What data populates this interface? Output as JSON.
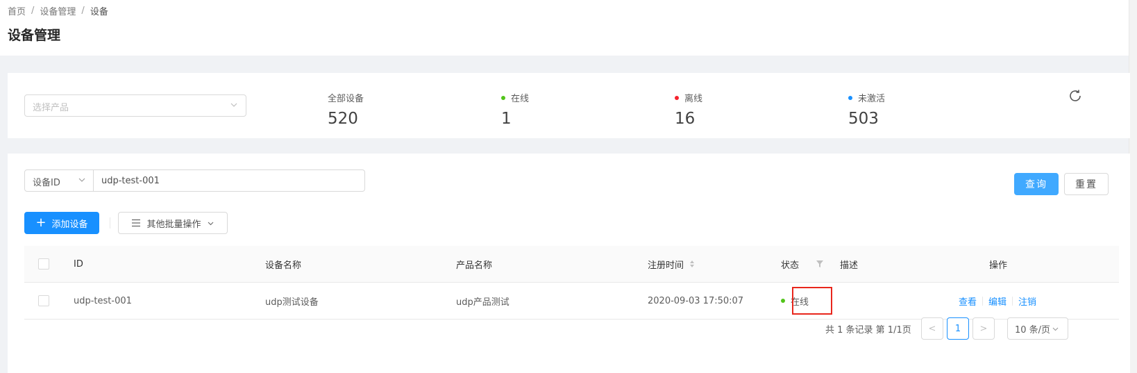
{
  "breadcrumb": {
    "items": [
      "首页",
      "设备管理",
      "设备"
    ],
    "separator": "/"
  },
  "page_title": "设备管理",
  "stats": {
    "product_select": {
      "placeholder": "选择产品"
    },
    "all": {
      "label": "全部设备",
      "value": "520"
    },
    "online": {
      "label": "在线",
      "value": "1",
      "color": "#52c41a"
    },
    "offline": {
      "label": "离线",
      "value": "16",
      "color": "#f5222d"
    },
    "inactive": {
      "label": "未激活",
      "value": "503",
      "color": "#1890ff"
    },
    "refresh_icon": "refresh-icon"
  },
  "search": {
    "field": "设备ID",
    "value": "udp-test-001",
    "query_label": "查询",
    "reset_label": "重置"
  },
  "toolbar": {
    "add_label": "添加设备",
    "add_icon": "+",
    "batch_label": "其他批量操作"
  },
  "table": {
    "columns": {
      "id": "ID",
      "name": "设备名称",
      "product": "产品名称",
      "reg_time": "注册时间",
      "status": "状态",
      "desc": "描述",
      "ops": "操作"
    },
    "rows": [
      {
        "id": "udp-test-001",
        "name": "udp测试设备",
        "product": "udp产品测试",
        "reg_time": "2020-09-03 17:50:07",
        "status": "在线",
        "status_color": "#52c41a",
        "desc": "",
        "actions": [
          "查看",
          "编辑",
          "注销"
        ]
      }
    ]
  },
  "pagination": {
    "total_text": "共 1 条记录 第 1/1页",
    "current": "1",
    "prev": "<",
    "next": ">",
    "page_size": "10 条/页"
  },
  "colors": {
    "primary": "#1890ff",
    "highlight_box": "#e8261c"
  }
}
